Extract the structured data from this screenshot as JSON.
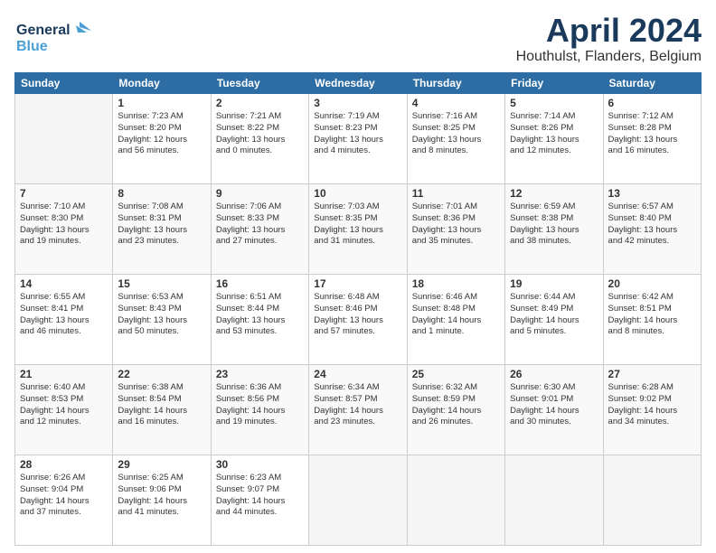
{
  "logo": {
    "line1": "General",
    "line2": "Blue"
  },
  "title": "April 2024",
  "subtitle": "Houthulst, Flanders, Belgium",
  "days_of_week": [
    "Sunday",
    "Monday",
    "Tuesday",
    "Wednesday",
    "Thursday",
    "Friday",
    "Saturday"
  ],
  "weeks": [
    [
      {
        "day": "",
        "content": ""
      },
      {
        "day": "1",
        "content": "Sunrise: 7:23 AM\nSunset: 8:20 PM\nDaylight: 12 hours\nand 56 minutes."
      },
      {
        "day": "2",
        "content": "Sunrise: 7:21 AM\nSunset: 8:22 PM\nDaylight: 13 hours\nand 0 minutes."
      },
      {
        "day": "3",
        "content": "Sunrise: 7:19 AM\nSunset: 8:23 PM\nDaylight: 13 hours\nand 4 minutes."
      },
      {
        "day": "4",
        "content": "Sunrise: 7:16 AM\nSunset: 8:25 PM\nDaylight: 13 hours\nand 8 minutes."
      },
      {
        "day": "5",
        "content": "Sunrise: 7:14 AM\nSunset: 8:26 PM\nDaylight: 13 hours\nand 12 minutes."
      },
      {
        "day": "6",
        "content": "Sunrise: 7:12 AM\nSunset: 8:28 PM\nDaylight: 13 hours\nand 16 minutes."
      }
    ],
    [
      {
        "day": "7",
        "content": "Sunrise: 7:10 AM\nSunset: 8:30 PM\nDaylight: 13 hours\nand 19 minutes."
      },
      {
        "day": "8",
        "content": "Sunrise: 7:08 AM\nSunset: 8:31 PM\nDaylight: 13 hours\nand 23 minutes."
      },
      {
        "day": "9",
        "content": "Sunrise: 7:06 AM\nSunset: 8:33 PM\nDaylight: 13 hours\nand 27 minutes."
      },
      {
        "day": "10",
        "content": "Sunrise: 7:03 AM\nSunset: 8:35 PM\nDaylight: 13 hours\nand 31 minutes."
      },
      {
        "day": "11",
        "content": "Sunrise: 7:01 AM\nSunset: 8:36 PM\nDaylight: 13 hours\nand 35 minutes."
      },
      {
        "day": "12",
        "content": "Sunrise: 6:59 AM\nSunset: 8:38 PM\nDaylight: 13 hours\nand 38 minutes."
      },
      {
        "day": "13",
        "content": "Sunrise: 6:57 AM\nSunset: 8:40 PM\nDaylight: 13 hours\nand 42 minutes."
      }
    ],
    [
      {
        "day": "14",
        "content": "Sunrise: 6:55 AM\nSunset: 8:41 PM\nDaylight: 13 hours\nand 46 minutes."
      },
      {
        "day": "15",
        "content": "Sunrise: 6:53 AM\nSunset: 8:43 PM\nDaylight: 13 hours\nand 50 minutes."
      },
      {
        "day": "16",
        "content": "Sunrise: 6:51 AM\nSunset: 8:44 PM\nDaylight: 13 hours\nand 53 minutes."
      },
      {
        "day": "17",
        "content": "Sunrise: 6:48 AM\nSunset: 8:46 PM\nDaylight: 13 hours\nand 57 minutes."
      },
      {
        "day": "18",
        "content": "Sunrise: 6:46 AM\nSunset: 8:48 PM\nDaylight: 14 hours\nand 1 minute."
      },
      {
        "day": "19",
        "content": "Sunrise: 6:44 AM\nSunset: 8:49 PM\nDaylight: 14 hours\nand 5 minutes."
      },
      {
        "day": "20",
        "content": "Sunrise: 6:42 AM\nSunset: 8:51 PM\nDaylight: 14 hours\nand 8 minutes."
      }
    ],
    [
      {
        "day": "21",
        "content": "Sunrise: 6:40 AM\nSunset: 8:53 PM\nDaylight: 14 hours\nand 12 minutes."
      },
      {
        "day": "22",
        "content": "Sunrise: 6:38 AM\nSunset: 8:54 PM\nDaylight: 14 hours\nand 16 minutes."
      },
      {
        "day": "23",
        "content": "Sunrise: 6:36 AM\nSunset: 8:56 PM\nDaylight: 14 hours\nand 19 minutes."
      },
      {
        "day": "24",
        "content": "Sunrise: 6:34 AM\nSunset: 8:57 PM\nDaylight: 14 hours\nand 23 minutes."
      },
      {
        "day": "25",
        "content": "Sunrise: 6:32 AM\nSunset: 8:59 PM\nDaylight: 14 hours\nand 26 minutes."
      },
      {
        "day": "26",
        "content": "Sunrise: 6:30 AM\nSunset: 9:01 PM\nDaylight: 14 hours\nand 30 minutes."
      },
      {
        "day": "27",
        "content": "Sunrise: 6:28 AM\nSunset: 9:02 PM\nDaylight: 14 hours\nand 34 minutes."
      }
    ],
    [
      {
        "day": "28",
        "content": "Sunrise: 6:26 AM\nSunset: 9:04 PM\nDaylight: 14 hours\nand 37 minutes."
      },
      {
        "day": "29",
        "content": "Sunrise: 6:25 AM\nSunset: 9:06 PM\nDaylight: 14 hours\nand 41 minutes."
      },
      {
        "day": "30",
        "content": "Sunrise: 6:23 AM\nSunset: 9:07 PM\nDaylight: 14 hours\nand 44 minutes."
      },
      {
        "day": "",
        "content": ""
      },
      {
        "day": "",
        "content": ""
      },
      {
        "day": "",
        "content": ""
      },
      {
        "day": "",
        "content": ""
      }
    ]
  ]
}
